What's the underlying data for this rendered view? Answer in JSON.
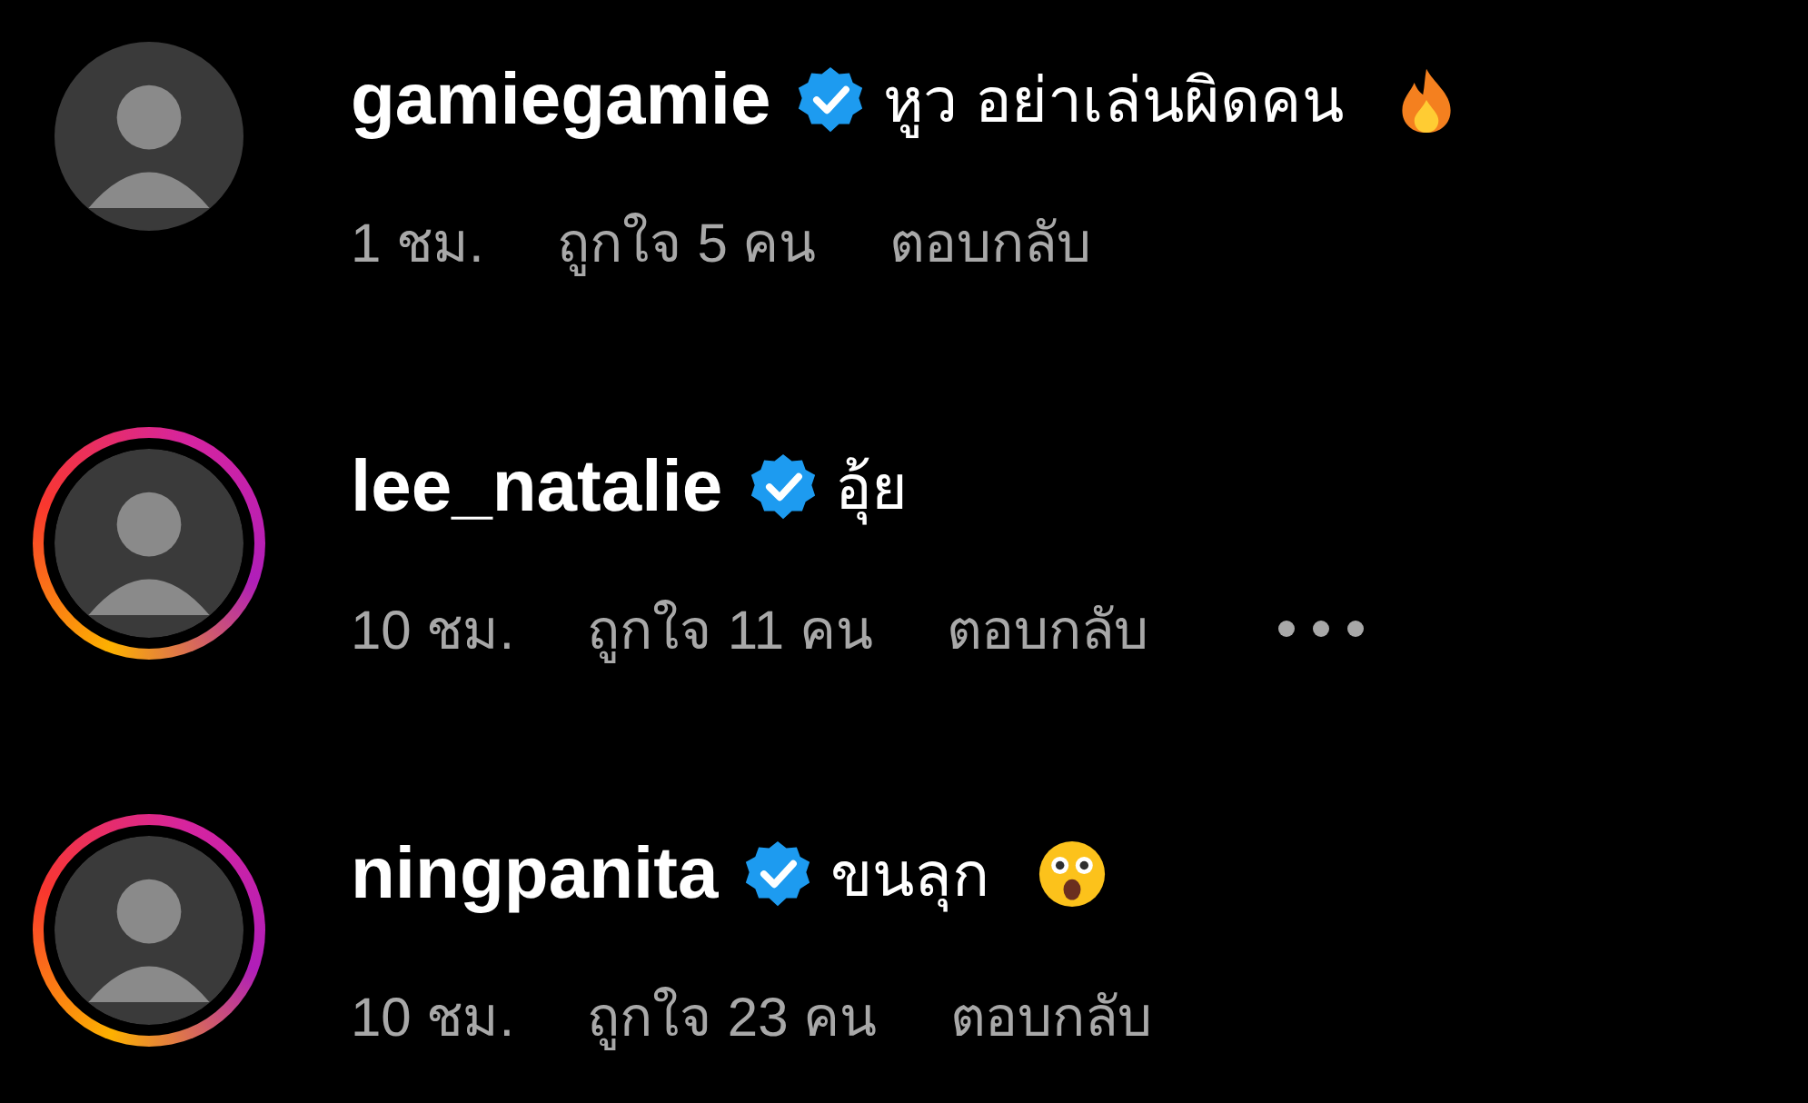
{
  "comments": [
    {
      "story_ring": false,
      "username": "gamiegamie",
      "verified": true,
      "text": "หูว อย่าเล่นผิดคน",
      "emoji": {
        "kind": "fire"
      },
      "time": "1 ชม.",
      "likes": "ถูกใจ 5 คน",
      "reply": "ตอบกลับ",
      "more_menu": false
    },
    {
      "story_ring": true,
      "username": "lee_natalie",
      "verified": true,
      "text": "อุ้ย",
      "time": "10 ชม.",
      "likes": "ถูกใจ 11 คน",
      "reply": "ตอบกลับ",
      "more_menu": true
    },
    {
      "story_ring": true,
      "username": "ningpanita",
      "verified": true,
      "text": "ขนลุก",
      "emoji": {
        "kind": "astonished"
      },
      "time": "10 ชม.",
      "likes": "ถูกใจ 23 คน",
      "reply": "ตอบกลับ",
      "more_menu": false
    }
  ]
}
